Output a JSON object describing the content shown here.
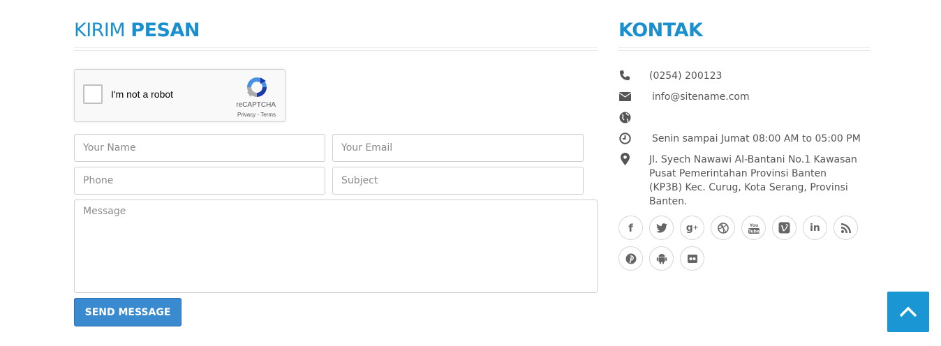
{
  "form_section": {
    "heading_light": "KIRIM",
    "heading_bold": "PESAN",
    "captcha": {
      "label": "I'm not a robot",
      "brand": "reCAPTCHA",
      "links": "Privacy - Terms"
    },
    "fields": {
      "name_placeholder": "Your Name",
      "email_placeholder": "Your Email",
      "phone_placeholder": "Phone",
      "subject_placeholder": "Subject",
      "message_placeholder": "Message"
    },
    "submit_label": "SEND MESSAGE"
  },
  "contact_section": {
    "heading": "KONTAK",
    "phone": "(0254) 200123",
    "email": "info@sitename.com",
    "website": "",
    "hours": "Senin sampai Jumat 08:00 AM to 05:00 PM",
    "address": "Jl. Syech Nawawi Al-Bantani No.1 Kawasan Pusat Pemerintahan Provinsi Banten (KP3B) Kec. Curug, Kota Serang, Provinsi Banten."
  },
  "social_icons": [
    "facebook-icon",
    "twitter-icon",
    "google-plus-icon",
    "dribbble-icon",
    "youtube-icon",
    "vimeo-icon",
    "linkedin-icon",
    "rss-icon",
    "pinterest-icon",
    "android-icon",
    "flickr-icon"
  ],
  "colors": {
    "accent": "#1a8fcf",
    "button": "#3a8ad0",
    "back_to_top": "#1a96d4"
  }
}
